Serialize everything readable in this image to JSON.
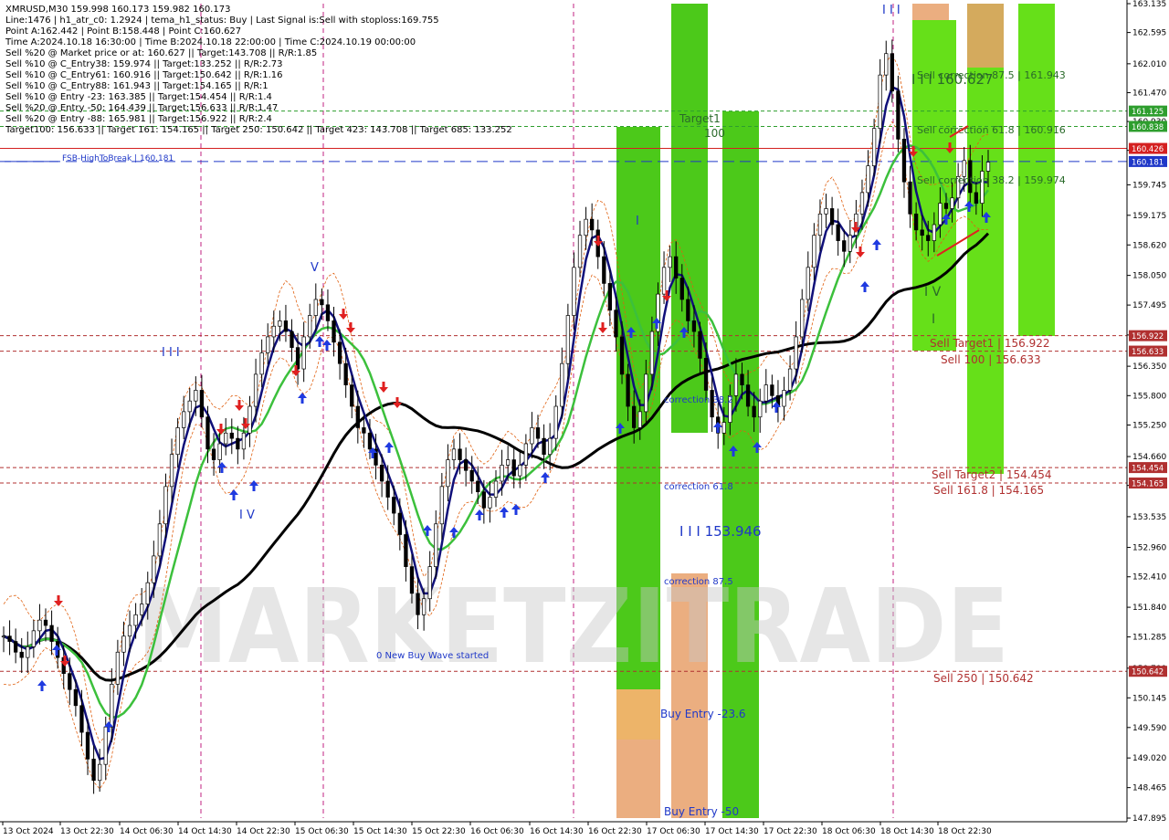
{
  "info_panel": {
    "lines": [
      "XMRUSD,M30   159.998 160.173 159.982 160.173",
      "Line:1476  |  h1_atr_c0: 1.2924  |  tema_h1_status: Buy  |  Last Signal is:Sell with stoploss:169.755",
      "Point A:162.442  |  Point B:158.448  |  Point C:160.627",
      "Time A:2024.10.18 16:30:00  |  Time B:2024.10.18 22:00:00  |  Time C:2024.10.19 00:00:00",
      "Sell %20 @ Market price or at: 160.627  ||  Target:143.708  ||  R/R:1.85",
      "Sell %10 @ C_Entry38: 159.974  ||  Target:133.252  ||  R/R:2.73",
      "Sell %10 @ C_Entry61: 160.916  ||  Target:150.642  ||  R/R:1.16",
      "Sell %10 @ C_Entry88: 161.943  ||  Target:154.165  ||  R/R:1",
      "Sell %10 @ Entry -23: 163.385  ||  Target:154.454  ||  R/R:1.4",
      "Sell %20 @ Entry -50: 164.439  ||  Target:156.633  ||  R/R:1.47",
      "Sell %20 @ Entry -88: 165.981  ||  Target:156.922  ||  R/R:2.4",
      "Target100: 156.633  ||  Target 161: 154.165  ||  Target 250: 150.642  ||  Target 423: 143.708  ||  Target 685: 133.252"
    ]
  },
  "watermark": "MARKETZITRADE",
  "chart_data": {
    "type": "candlestick",
    "symbol": "XMRUSD",
    "timeframe": "M30",
    "ylim": [
      147.895,
      163.135
    ],
    "y_ticks": [
      "163.135",
      "162.595",
      "162.010",
      "161.470",
      "160.930",
      "160.390",
      "159.745",
      "159.175",
      "158.620",
      "158.050",
      "157.495",
      "156.935",
      "156.350",
      "155.800",
      "155.250",
      "154.660",
      "154.120",
      "153.535",
      "152.960",
      "152.410",
      "151.840",
      "151.285",
      "150.700",
      "150.145",
      "149.590",
      "149.020",
      "148.465",
      "147.895"
    ],
    "x_labels": [
      "13 Oct 2024",
      "13 Oct 22:30",
      "14 Oct 06:30",
      "14 Oct 14:30",
      "14 Oct 22:30",
      "15 Oct 06:30",
      "15 Oct 14:30",
      "15 Oct 22:30",
      "16 Oct 06:30",
      "16 Oct 14:30",
      "16 Oct 22:30",
      "17 Oct 06:30",
      "17 Oct 14:30",
      "17 Oct 22:30",
      "18 Oct 06:30",
      "18 Oct 14:30",
      "18 Oct 22:30"
    ],
    "close_series": [
      151.3,
      151.2,
      151.0,
      150.9,
      151.1,
      151.4,
      151.6,
      151.5,
      151.2,
      150.9,
      150.6,
      150.3,
      150.0,
      149.5,
      149.0,
      148.6,
      148.9,
      149.6,
      150.4,
      151.0,
      151.3,
      151.5,
      151.7,
      151.9,
      152.3,
      152.8,
      153.4,
      154.1,
      154.7,
      155.2,
      155.5,
      155.7,
      155.9,
      155.4,
      154.8,
      154.6,
      154.9,
      155.1,
      155.0,
      154.8,
      155.1,
      155.6,
      156.2,
      156.6,
      156.9,
      157.1,
      157.2,
      157.0,
      156.7,
      156.3,
      156.9,
      157.3,
      157.6,
      157.5,
      157.2,
      156.8,
      156.4,
      156.0,
      155.6,
      155.2,
      155.1,
      154.8,
      154.5,
      154.2,
      153.9,
      153.6,
      153.2,
      152.6,
      152.1,
      151.7,
      152.0,
      152.6,
      153.4,
      154.1,
      154.6,
      154.8,
      154.6,
      154.4,
      154.2,
      154.0,
      153.7,
      153.9,
      154.2,
      154.5,
      154.6,
      154.3,
      154.5,
      154.9,
      155.2,
      155.0,
      154.7,
      155.0,
      155.6,
      156.4,
      157.3,
      158.2,
      158.8,
      159.1,
      158.9,
      158.4,
      157.9,
      157.4,
      156.9,
      156.2,
      155.6,
      155.2,
      155.5,
      156.2,
      157.0,
      157.7,
      158.2,
      158.4,
      158.0,
      157.6,
      157.2,
      157.0,
      156.5,
      155.9,
      155.4,
      155.1,
      155.3,
      155.8,
      156.2,
      156.0,
      155.6,
      155.4,
      155.7,
      156.0,
      155.8,
      155.6,
      155.9,
      156.3,
      156.9,
      157.6,
      158.2,
      158.8,
      159.2,
      159.3,
      159.0,
      158.7,
      158.5,
      158.8,
      159.2,
      159.6,
      160.1,
      160.8,
      161.8,
      162.2,
      161.5,
      160.6,
      159.8,
      159.2,
      158.9,
      158.8,
      158.7,
      159.0,
      159.4,
      159.3,
      159.5,
      159.9,
      160.2,
      159.6,
      159.4,
      160.0,
      160.17
    ],
    "current_price": 160.173,
    "levels": [
      {
        "label": "161.125",
        "value": 161.125,
        "color": "#2e9e2e",
        "style": "dashed"
      },
      {
        "label": "160.838",
        "value": 160.838,
        "color": "#2e9e2e",
        "style": "dashed"
      },
      {
        "label": "160.426",
        "value": 160.426,
        "color": "#d42020",
        "style": "solid"
      },
      {
        "label": "160.181",
        "value": 160.181,
        "color": "#1f38c8",
        "style": "dashed"
      },
      {
        "label": "156.922",
        "value": 156.922,
        "color": "#b03030",
        "style": "dashed"
      },
      {
        "label": "156.633",
        "value": 156.633,
        "color": "#b03030",
        "style": "dashed"
      },
      {
        "label": "154.454",
        "value": 154.454,
        "color": "#b03030",
        "style": "dashed"
      },
      {
        "label": "154.165",
        "value": 154.165,
        "color": "#b03030",
        "style": "dashed"
      },
      {
        "label": "150.642",
        "value": 150.642,
        "color": "#b03030",
        "style": "dashed"
      }
    ],
    "annotations": [
      {
        "text": "FSB-HighToBreak  |  160.181",
        "color": "#1f38c8"
      },
      {
        "text": "Sell correction 87.5  |  161.943",
        "color": "#2a6a2a"
      },
      {
        "text": "Sell correction 61.8  |  160.916",
        "color": "#2a6a2a"
      },
      {
        "text": "Sell correction 38.2  |  159.974",
        "color": "#2a6a2a"
      },
      {
        "text": "I I I 160.627",
        "color": "#2a6a2a"
      },
      {
        "text": "Sell Target1  |  156.922",
        "color": "#b03030"
      },
      {
        "text": "Sell 100  |  156.633",
        "color": "#b03030"
      },
      {
        "text": "Sell Target2  |  154.454",
        "color": "#b03030"
      },
      {
        "text": "Sell 161.8  |  154.165",
        "color": "#b03030"
      },
      {
        "text": "Sell  250  |  150.642",
        "color": "#b03030"
      },
      {
        "text": "Target1",
        "color": "#2a6a2a"
      },
      {
        "text": "100",
        "color": "#2a6a2a"
      },
      {
        "text": "correction 38.2",
        "color": "#1f38c8"
      },
      {
        "text": "correction 61.8",
        "color": "#1f38c8"
      },
      {
        "text": "correction 87.5",
        "color": "#1f38c8"
      },
      {
        "text": "I I I  153.946",
        "color": "#1f38c8"
      },
      {
        "text": "Buy Entry -23.6",
        "color": "#1f38c8"
      },
      {
        "text": "Buy Entry -50",
        "color": "#1f38c8"
      },
      {
        "text": "0 New Buy Wave started",
        "color": "#1f38c8"
      },
      {
        "text": "I I I",
        "color": "#1f38c8"
      },
      {
        "text": "V",
        "color": "#1f38c8"
      },
      {
        "text": "I V",
        "color": "#1f38c8"
      },
      {
        "text": "I",
        "color": "#1f38c8"
      },
      {
        "text": "I V",
        "color": "#2a6a2a"
      },
      {
        "text": "I",
        "color": "#2a6a2a"
      },
      {
        "text": "I I I",
        "color": "#1f38c8"
      }
    ],
    "zones": [
      {
        "name": "buy-zone-1",
        "color": "#4cc91a"
      },
      {
        "name": "buy-zone-2",
        "color": "#4cc91a"
      },
      {
        "name": "buy-zone-3",
        "color": "#4cc91a"
      },
      {
        "name": "sell-zone-1",
        "color": "#66e019"
      },
      {
        "name": "sell-zone-2",
        "color": "#66e019"
      },
      {
        "name": "sell-zone-3",
        "color": "#66e019"
      },
      {
        "name": "entry-zone",
        "color": "#e8a06a"
      }
    ],
    "ma_colors": {
      "ma_slow": "#000000",
      "ma_mid": "#3cc03c",
      "ma_fast": "#10107a",
      "envelope": "#e06010"
    }
  }
}
